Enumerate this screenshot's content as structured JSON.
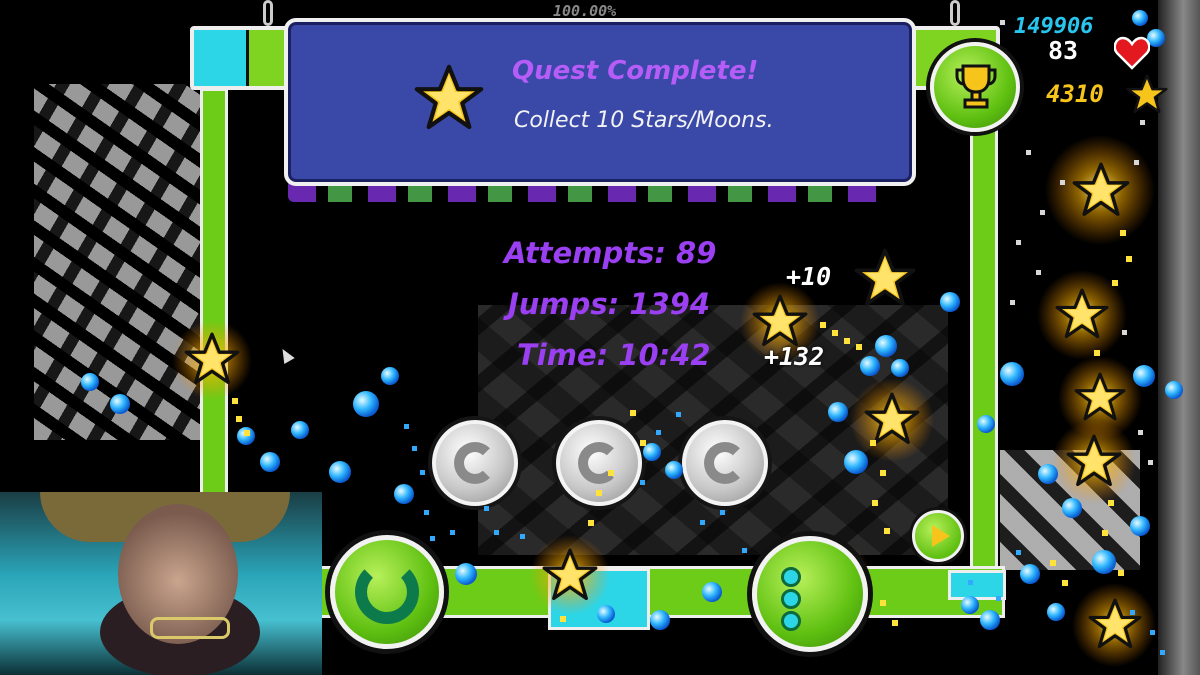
{
  "background": {
    "progress_text": "100.00%"
  },
  "quest_popup": {
    "title": "Quest Complete!",
    "description": "Collect 10 Stars/Moons.",
    "icon": "star-icon"
  },
  "level_complete": {
    "stats": {
      "attempts": "Attempts: 89",
      "jumps": "Jumps: 1394",
      "time": "Time: 10:42"
    },
    "coins": [
      "silver-coin",
      "silver-coin",
      "silver-coin"
    ],
    "rewards": {
      "stars": "+10",
      "orbs": "+132"
    },
    "buttons": {
      "retry": "retry-icon",
      "menu": "menu-icon",
      "play": "play-icon",
      "trophy": "trophy-icon"
    }
  },
  "hud": {
    "orbs_total": "149906",
    "lives": "83",
    "stars_total": "4310"
  },
  "colors": {
    "frame_green": "#6dcc17",
    "frame_cyan": "#2dd6e6",
    "stat_purple": "#9b3ff3",
    "quest_bg": "#3a49a8",
    "star_yellow": "#f6c41b",
    "orb_blue": "#2fb6ff"
  }
}
